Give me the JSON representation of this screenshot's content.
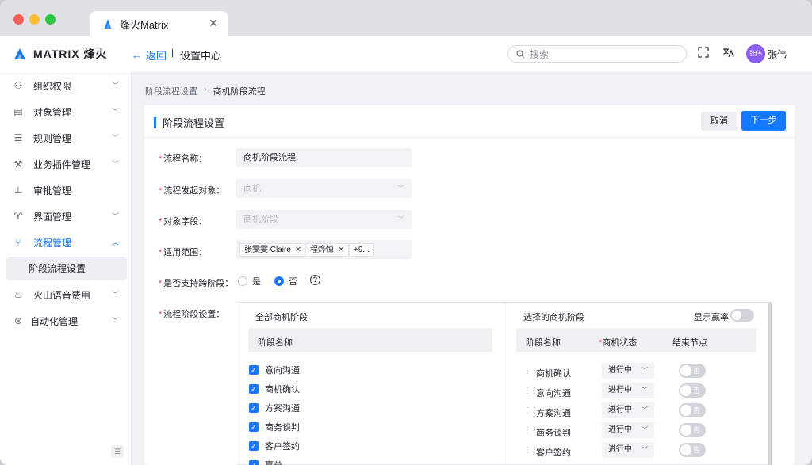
{
  "browser": {
    "tab_title": "烽火Matrix",
    "close": "✕"
  },
  "header": {
    "logo_text": "MATRIX 烽火",
    "back_label": "返回",
    "separator": "|",
    "location": "设置中心",
    "search_placeholder": "搜索",
    "avatar_text": "张伟",
    "user_name": "张伟"
  },
  "sidebar": {
    "items": [
      {
        "label": "组织权限",
        "icon": "users-icon"
      },
      {
        "label": "对象管理",
        "icon": "table-icon"
      },
      {
        "label": "规则管理",
        "icon": "list-icon"
      },
      {
        "label": "业务插件管理",
        "icon": "wrench-icon"
      },
      {
        "label": "审批管理",
        "icon": "stamp-icon"
      },
      {
        "label": "界面管理",
        "icon": "shirt-icon"
      },
      {
        "label": "流程管理",
        "icon": "flow-icon"
      },
      {
        "label": "火山语音费用",
        "icon": "flame-icon"
      },
      {
        "label": "自动化管理",
        "icon": "automation-icon"
      }
    ],
    "subitem": "阶段流程设置"
  },
  "breadcrumb": {
    "parent": "阶段流程设置",
    "current": "商机阶段流程"
  },
  "panel": {
    "title": "阶段流程设置",
    "cancel": "取消",
    "next": "下一步"
  },
  "form": {
    "name_label": "流程名称：",
    "name_value": "商机阶段流程",
    "object_label": "流程发起对象：",
    "object_value": "商机",
    "field_label": "对象字段：",
    "field_value": "商机阶段",
    "scope_label": "适用范围：",
    "scope_tags": [
      "张雯雯 Claire",
      "程烨恒"
    ],
    "scope_more": "+9...",
    "cross_label": "是否支持跨阶段：",
    "opt_yes": "是",
    "opt_no": "否",
    "selected_option": "否",
    "stages_label": "流程阶段设置："
  },
  "all_stages": {
    "title": "全部商机阶段",
    "column": "阶段名称",
    "items": [
      "意向沟通",
      "商机确认",
      "方案沟通",
      "商务谈判",
      "客户签约",
      "赢单"
    ]
  },
  "selected_stages": {
    "title": "选择的商机阶段",
    "show_win_rate": "显示赢率",
    "col_name": "阶段名称",
    "col_status": "商机状态",
    "col_end": "结束节点",
    "rows": [
      {
        "name": "商机确认",
        "status": "进行中",
        "end": "否"
      },
      {
        "name": "意向沟通",
        "status": "进行中",
        "end": "否"
      },
      {
        "name": "方案沟通",
        "status": "进行中",
        "end": "否"
      },
      {
        "name": "商务谈判",
        "status": "进行中",
        "end": "否"
      },
      {
        "name": "客户签约",
        "status": "进行中",
        "end": "否"
      }
    ]
  },
  "colors": {
    "accent": "#1677ff",
    "required": "#e34d59",
    "avatar": "#8b5cf6"
  }
}
